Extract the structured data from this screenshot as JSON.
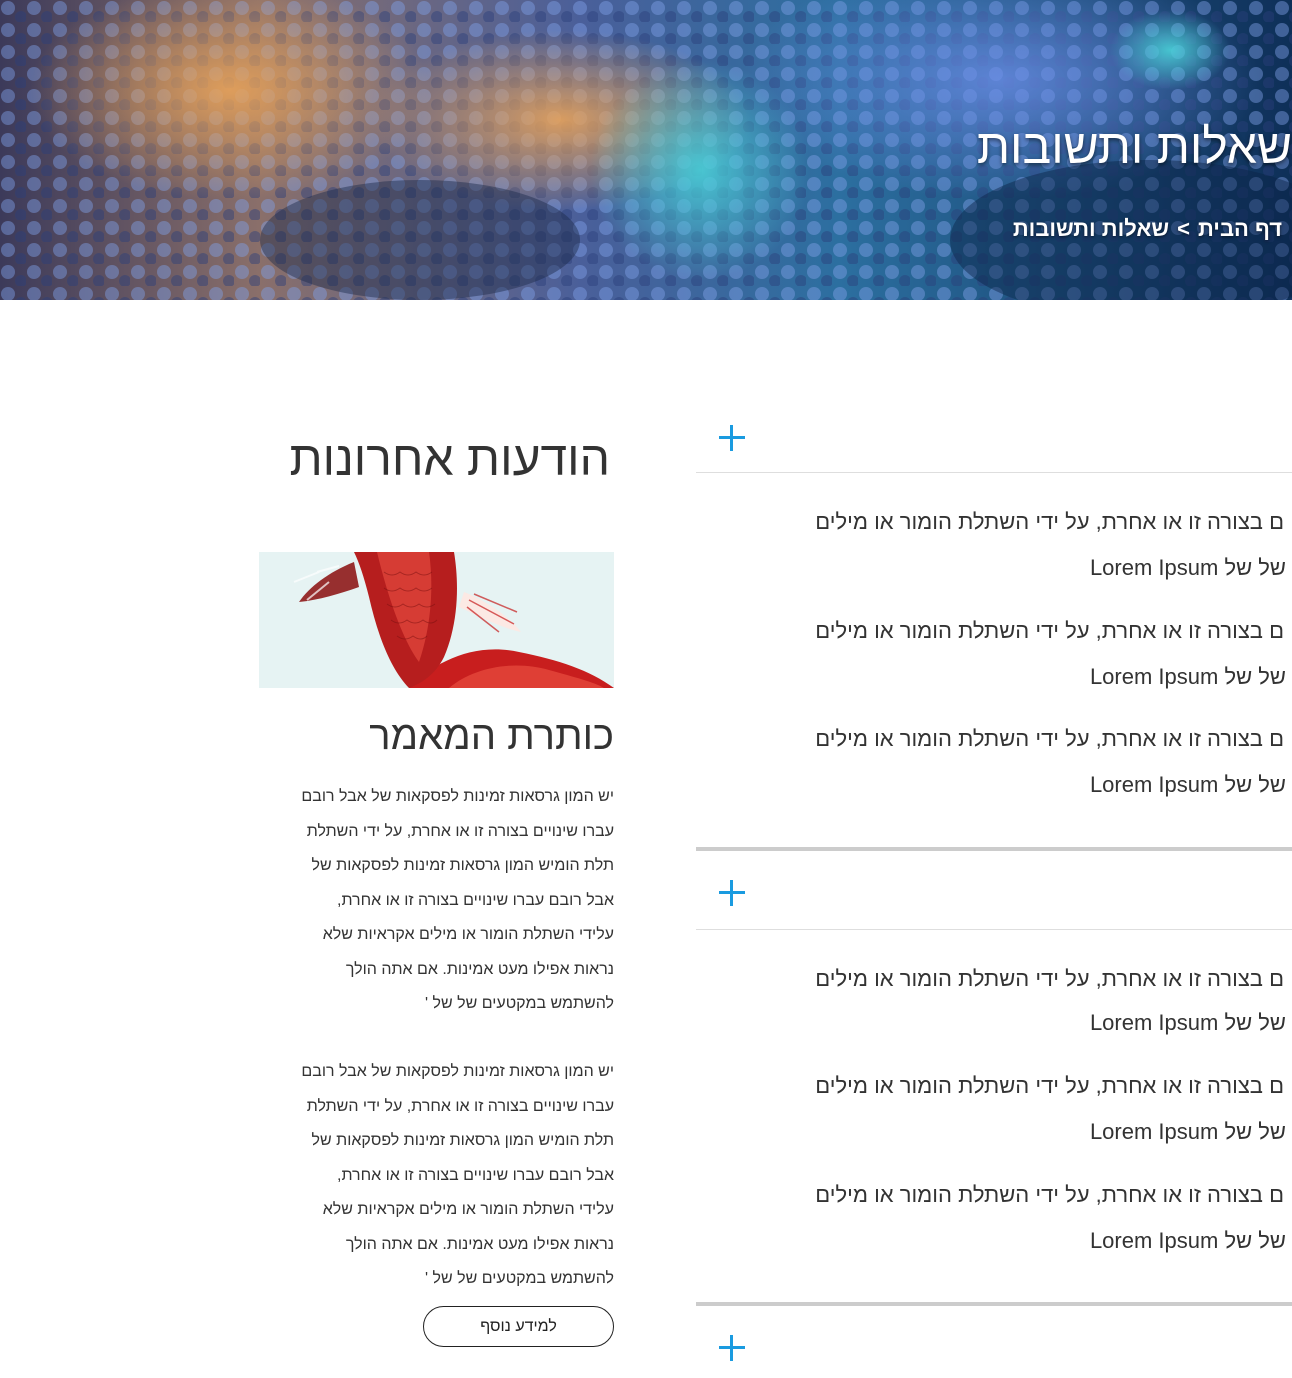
{
  "hero": {
    "title": "שאלות ותשובות",
    "breadcrumb": {
      "home": "דף הבית",
      "separator": ">",
      "current": "שאלות ותשובות"
    }
  },
  "news": {
    "heading": "הודעות אחרונות",
    "article_title": "כותרת המאמר",
    "paragraph1": [
      "יש המון גרסאות זמינות לפסקאות של אבל רובם",
      "עברו שינויים בצורה זו או אחרת, על ידי השתלת",
      "תלת הומיש המון גרסאות זמינות לפסקאות של",
      "אבל רובם עברו שינויים בצורה זו או אחרת,",
      "עלידי השתלת הומור או מילים אקראיות שלא",
      "נראות אפילו מעט אמינות. אם אתה הולך",
      "להשתמש במקטעים של של '"
    ],
    "paragraph2": [
      "יש המון גרסאות זמינות לפסקאות של אבל רובם",
      "עברו שינויים בצורה זו או אחרת, על ידי השתלת",
      "תלת הומיש המון גרסאות זמינות לפסקאות של",
      "אבל רובם עברו שינויים בצורה זו או אחרת,",
      "עלידי השתלת הומור או מילים אקראיות שלא",
      "נראות אפילו מעט אמינות. אם אתה הולך",
      "להשתמש במקטעים של של '"
    ],
    "more_button": "למידע נוסף"
  },
  "faq": {
    "line_a": "ם בצורה זו או אחרת, על ידי השתלת הומור או מילים",
    "line_b_prefix": "של של",
    "line_b_lorem": "Lorem Ipsum",
    "accent_color": "#1a9be0"
  },
  "icons": {
    "faq_toggle": "plus-icon"
  }
}
